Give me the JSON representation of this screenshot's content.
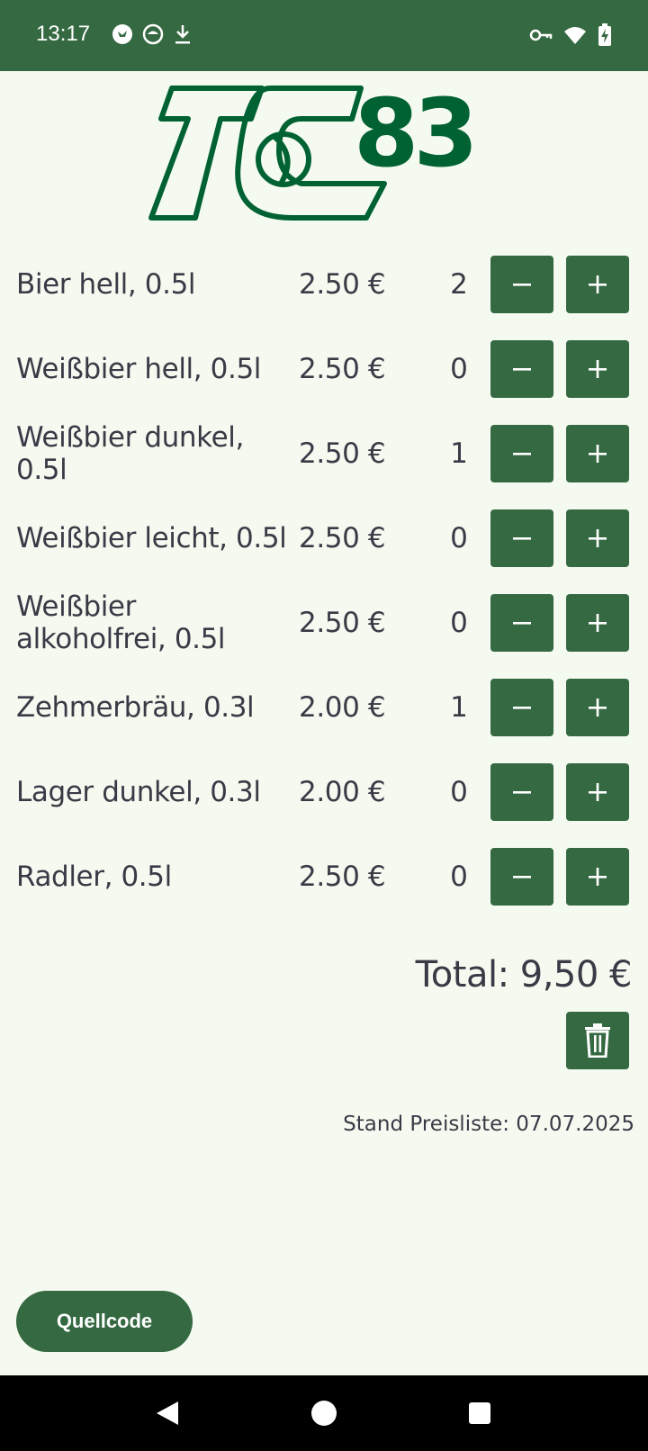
{
  "status_bar": {
    "time": "13:17",
    "left_icons": [
      "bird-icon",
      "cat-icon",
      "download-icon"
    ],
    "right_icons": [
      "vpn-key-icon",
      "wifi-icon",
      "battery-charging-icon"
    ]
  },
  "logo": {
    "text": "TC 83",
    "color": "#006233"
  },
  "items": [
    {
      "name": "Bier hell, 0.5l",
      "price": "2.50 €",
      "qty": "2"
    },
    {
      "name": "Weißbier hell, 0.5l",
      "price": "2.50 €",
      "qty": "0"
    },
    {
      "name": "Weißbier dunkel, 0.5l",
      "price": "2.50 €",
      "qty": "1"
    },
    {
      "name": "Weißbier leicht, 0.5l",
      "price": "2.50 €",
      "qty": "0"
    },
    {
      "name": "Weißbier alkoholfrei, 0.5l",
      "price": "2.50 €",
      "qty": "0"
    },
    {
      "name": "Zehmerbräu, 0.3l",
      "price": "2.00 €",
      "qty": "1"
    },
    {
      "name": "Lager dunkel, 0.3l",
      "price": "2.00 €",
      "qty": "0"
    },
    {
      "name": "Radler, 0.5l",
      "price": "2.50 €",
      "qty": "0"
    }
  ],
  "buttons": {
    "minus_label": "−",
    "plus_label": "+"
  },
  "total": "Total: 9,50 €",
  "price_list_date": "Stand Preisliste: 07.07.2025",
  "source_button": "Quellcode",
  "colors": {
    "primary": "#356942",
    "background": "#f5faf0",
    "text": "#3a3a46",
    "logo": "#006233"
  }
}
